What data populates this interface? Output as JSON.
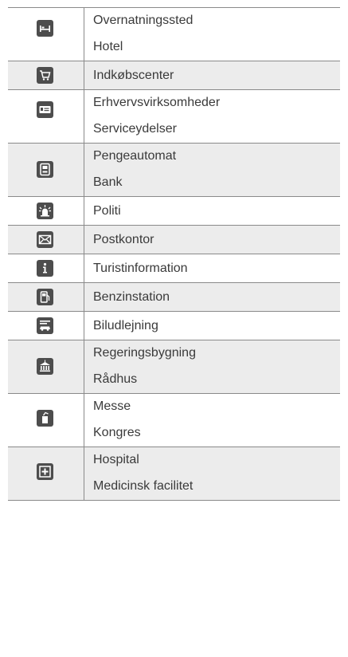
{
  "rows": [
    {
      "icon": "bed-icon",
      "lines": [
        "Overnatningssted",
        "Hotel"
      ],
      "shaded": false
    },
    {
      "icon": "shopping-cart-icon",
      "lines": [
        "Indkøbscenter"
      ],
      "shaded": true
    },
    {
      "icon": "business-card-icon",
      "lines": [
        "Erhvervsvirksomheder",
        "Serviceydelser"
      ],
      "shaded": false
    },
    {
      "icon": "atm-icon",
      "lines": [
        "Pengeautomat",
        "Bank"
      ],
      "shaded": true
    },
    {
      "icon": "police-light-icon",
      "lines": [
        "Politi"
      ],
      "shaded": false
    },
    {
      "icon": "envelope-icon",
      "lines": [
        "Postkontor"
      ],
      "shaded": true
    },
    {
      "icon": "info-icon",
      "lines": [
        "Turistinformation"
      ],
      "shaded": false
    },
    {
      "icon": "fuel-pump-icon",
      "lines": [
        "Benzinstation"
      ],
      "shaded": true
    },
    {
      "icon": "car-rental-icon",
      "lines": [
        "Biludlejning"
      ],
      "shaded": false
    },
    {
      "icon": "government-building-icon",
      "lines": [
        "Regeringsbygning",
        "Rådhus"
      ],
      "shaded": true
    },
    {
      "icon": "exhibition-icon",
      "lines": [
        "Messe",
        "Kongres"
      ],
      "shaded": false
    },
    {
      "icon": "hospital-cross-icon",
      "lines": [
        "Hospital",
        "Medicinsk facilitet"
      ],
      "shaded": true
    }
  ]
}
